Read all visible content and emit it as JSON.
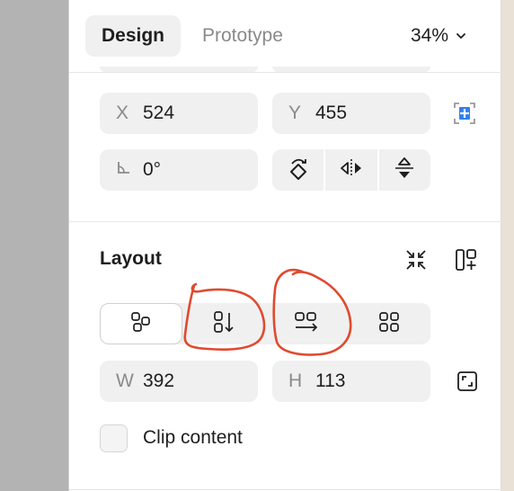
{
  "tabs": {
    "design": "Design",
    "prototype": "Prototype"
  },
  "zoom": {
    "value": "34%"
  },
  "position": {
    "x_label": "X",
    "x_value": "524",
    "y_label": "Y",
    "y_value": "455"
  },
  "rotation": {
    "value": "0°"
  },
  "layout": {
    "title": "Layout",
    "w_label": "W",
    "w_value": "392",
    "h_label": "H",
    "h_value": "113"
  },
  "clip": {
    "label": "Clip content",
    "checked": false
  },
  "icons": {
    "zoom_dropdown": "chevron-down-icon",
    "constraints": "constraints-icon",
    "rotate": "rotate-90-icon",
    "flip_h": "flip-horizontal-icon",
    "flip_v": "flip-vertical-icon",
    "remove_auto_layout": "collapse-icon",
    "add_auto_layout": "add-layout-icon",
    "resize": "resize-to-fit-icon"
  },
  "colors": {
    "accent": "#2f80ed",
    "annotation": "#e04a2f",
    "field_bg": "#f0f0f0"
  }
}
